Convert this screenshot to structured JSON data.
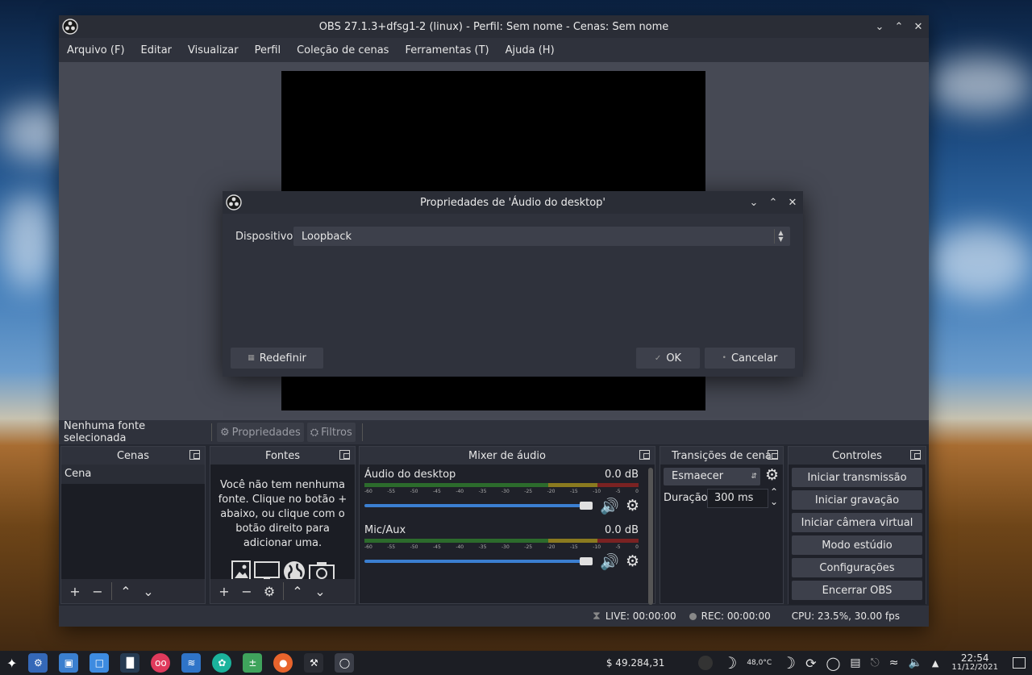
{
  "window": {
    "title": "OBS 27.1.3+dfsg1-2 (linux) - Perfil: Sem nome - Cenas: Sem nome"
  },
  "menu": [
    "Arquivo (F)",
    "Editar",
    "Visualizar",
    "Perfil",
    "Coleção de cenas",
    "Ferramentas (T)",
    "Ajuda (H)"
  ],
  "source_bar": {
    "label": "Nenhuma fonte selecionada",
    "properties": "Propriedades",
    "filters": "Filtros"
  },
  "docks": {
    "scenes": {
      "title": "Cenas",
      "items": [
        "Cena"
      ]
    },
    "sources": {
      "title": "Fontes",
      "empty_text": "Você não tem nenhuma fonte. Clique no botão + abaixo, ou clique com o botão direito para adicionar uma."
    },
    "mixer": {
      "title": "Mixer de áudio",
      "ticks": [
        "-60",
        "-55",
        "-50",
        "-45",
        "-40",
        "-35",
        "-30",
        "-25",
        "-20",
        "-15",
        "-10",
        "-5",
        "0"
      ],
      "channels": [
        {
          "name": "Áudio do desktop",
          "db": "0.0 dB",
          "volume": 1.0
        },
        {
          "name": "Mic/Aux",
          "db": "0.0 dB",
          "volume": 1.0
        }
      ]
    },
    "transitions": {
      "title": "Transições de cena",
      "selected": "Esmaecer",
      "duration_label": "Duração",
      "duration_value": "300 ms"
    },
    "controls": {
      "title": "Controles",
      "buttons": [
        "Iniciar transmissão",
        "Iniciar gravação",
        "Iniciar câmera virtual",
        "Modo estúdio",
        "Configurações",
        "Encerrar OBS"
      ]
    }
  },
  "status": {
    "live": "LIVE: 00:00:00",
    "rec": "REC: 00:00:00",
    "cpu": "CPU: 23.5%, 30.00 fps"
  },
  "dialog": {
    "title": "Propriedades de 'Áudio do desktop'",
    "device_label": "Dispositivo",
    "device_value": "Loopback",
    "reset": "Redefinir",
    "ok": "OK",
    "cancel": "Cancelar"
  },
  "taskbar": {
    "money": "$ 49.284,31",
    "temp": "48,0°C",
    "time": "22:54",
    "date": "11/12/2021"
  }
}
